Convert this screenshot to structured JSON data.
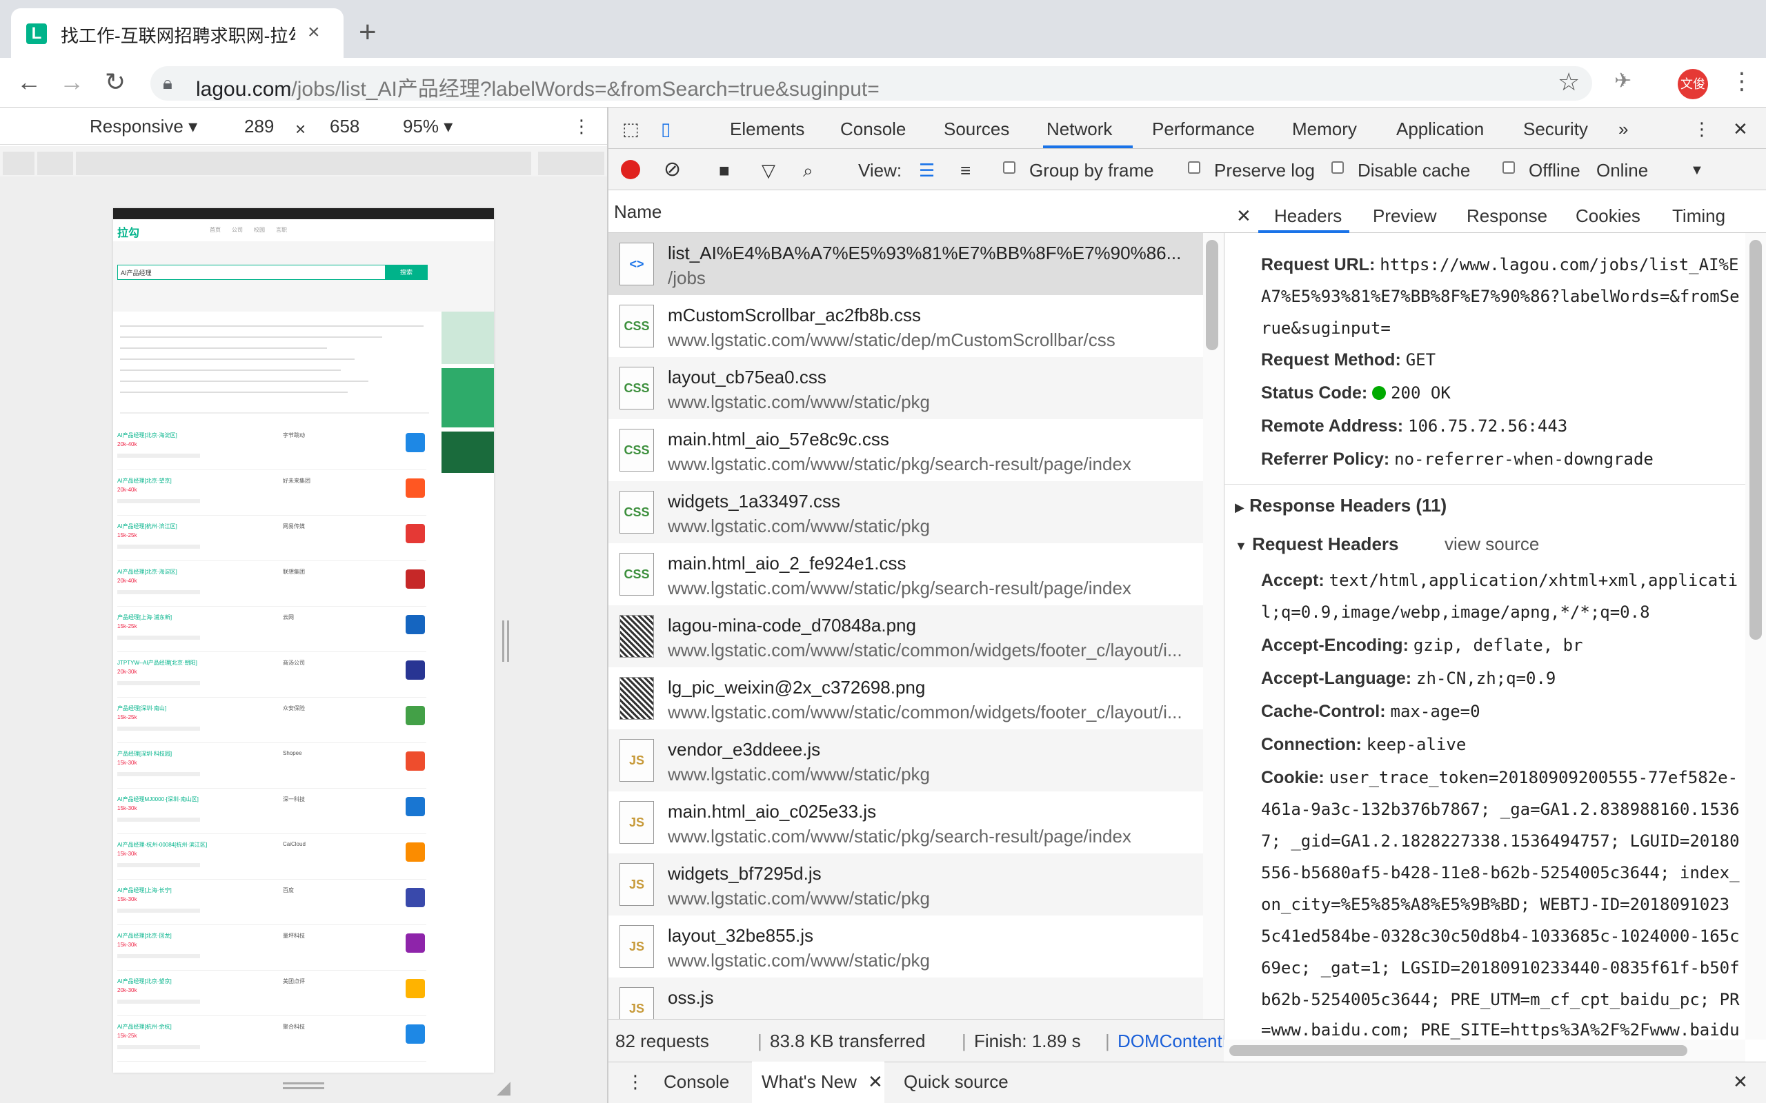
{
  "browser": {
    "tab_title": "找工作-互联网招聘求职网-拉勾网",
    "url_host": "lagou.com",
    "url_path": "/jobs/list_AI产品经理?labelWords=&fromSearch=true&suginput=",
    "profile": "文俊"
  },
  "device_toolbar": {
    "mode": "Responsive",
    "width": "289",
    "times": "×",
    "height": "658",
    "zoom": "95%"
  },
  "page_preview": {
    "logo": "拉勾",
    "search_value": "AI产品经理",
    "search_button": "搜索",
    "jobs": [
      {
        "title": "AI产品经理[北京·海淀区]",
        "salary": "20k-40k",
        "company": "字节跳动"
      },
      {
        "title": "AI产品经理[北京·望京]",
        "salary": "20k-40k",
        "company": "好未来集团"
      },
      {
        "title": "AI产品经理[杭州·滨江区]",
        "salary": "15k-25k",
        "company": "网易传媒"
      },
      {
        "title": "AI产品经理[北京·海淀区]",
        "salary": "20k-40k",
        "company": "联想集团"
      },
      {
        "title": "产品经理[上海·浦东新]",
        "salary": "15k-25k",
        "company": "云网"
      },
      {
        "title": "JTPTYW--AI产品经理[北京·朝阳]",
        "salary": "20k-30k",
        "company": "商汤公司"
      },
      {
        "title": "产品经理[深圳·南山]",
        "salary": "15k-25k",
        "company": "众安保险"
      },
      {
        "title": "产品经理[深圳·科技园]",
        "salary": "15k-30k",
        "company": "Shopee"
      },
      {
        "title": "AI产品经理MJ0000·[深圳·南山区]",
        "salary": "15k-30k",
        "company": "深一科技"
      },
      {
        "title": "AI产品经理-杭州-00084[杭州·滨江区]",
        "salary": "15k-30k",
        "company": "CaiCloud"
      },
      {
        "title": "AI产品经理[上海·长宁]",
        "salary": "15k-30k",
        "company": "百度"
      },
      {
        "title": "AI产品经理[北京·回龙]",
        "salary": "15k-30k",
        "company": "量坪科技"
      },
      {
        "title": "AI产品经理[北京·望京]",
        "salary": "20k-30k",
        "company": "美团点评"
      },
      {
        "title": "AI产品经理[杭州·余杭]",
        "salary": "15k-25k",
        "company": "聚合科技"
      }
    ]
  },
  "devtools": {
    "tabs": [
      "Elements",
      "Console",
      "Sources",
      "Network",
      "Performance",
      "Memory",
      "Application",
      "Security"
    ],
    "active_tab": "Network",
    "more": "»",
    "toolbar": {
      "view_label": "View:",
      "group_by_frame": "Group by frame",
      "preserve_log": "Preserve log",
      "disable_cache": "Disable cache",
      "offline": "Offline",
      "throttle": "Online"
    },
    "list_header": "Name",
    "requests": [
      {
        "name": "list_AI%E4%BA%A7%E5%93%81%E7%BB%8F%E7%90%86...",
        "path": "/jobs",
        "type": "doc",
        "icon_text": "<>"
      },
      {
        "name": "mCustomScrollbar_ac2fb8b.css",
        "path": "www.lgstatic.com/www/static/dep/mCustomScrollbar/css",
        "type": "css",
        "icon_text": "CSS"
      },
      {
        "name": "layout_cb75ea0.css",
        "path": "www.lgstatic.com/www/static/pkg",
        "type": "css",
        "icon_text": "CSS"
      },
      {
        "name": "main.html_aio_57e8c9c.css",
        "path": "www.lgstatic.com/www/static/pkg/search-result/page/index",
        "type": "css",
        "icon_text": "CSS"
      },
      {
        "name": "widgets_1a33497.css",
        "path": "www.lgstatic.com/www/static/pkg",
        "type": "css",
        "icon_text": "CSS"
      },
      {
        "name": "main.html_aio_2_fe924e1.css",
        "path": "www.lgstatic.com/www/static/pkg/search-result/page/index",
        "type": "css",
        "icon_text": "CSS"
      },
      {
        "name": "lagou-mina-code_d70848a.png",
        "path": "www.lgstatic.com/www/static/common/widgets/footer_c/layout/i...",
        "type": "img",
        "icon_text": ""
      },
      {
        "name": "lg_pic_weixin@2x_c372698.png",
        "path": "www.lgstatic.com/www/static/common/widgets/footer_c/layout/i...",
        "type": "img",
        "icon_text": ""
      },
      {
        "name": "vendor_e3ddeee.js",
        "path": "www.lgstatic.com/www/static/pkg",
        "type": "js",
        "icon_text": "JS"
      },
      {
        "name": "main.html_aio_c025e33.js",
        "path": "www.lgstatic.com/www/static/pkg/search-result/page/index",
        "type": "js",
        "icon_text": "JS"
      },
      {
        "name": "widgets_bf7295d.js",
        "path": "www.lgstatic.com/www/static/pkg",
        "type": "js",
        "icon_text": "JS"
      },
      {
        "name": "layout_32be855.js",
        "path": "www.lgstatic.com/www/static/pkg",
        "type": "js",
        "icon_text": "JS"
      },
      {
        "name": "oss.js",
        "path": "",
        "type": "js",
        "icon_text": "JS"
      }
    ],
    "status_bar": {
      "requests": "82 requests",
      "transferred": "83.8 KB transferred",
      "finish": "Finish: 1.89 s",
      "dcl": "DOMContentLoaded: ..."
    },
    "detail_tabs": [
      "Headers",
      "Preview",
      "Response",
      "Cookies",
      "Timing"
    ],
    "general": {
      "request_url_label": "Request URL:",
      "request_url_1": "https://www.lagou.com/jobs/list_AI%E",
      "request_url_2": "A7%E5%93%81%E7%BB%8F%E7%90%86?labelWords=&fromSe",
      "request_url_3": "rue&suginput=",
      "method_label": "Request Method:",
      "method": "GET",
      "status_label": "Status Code:",
      "status": "200 OK",
      "status_color": "#0a0",
      "remote_label": "Remote Address:",
      "remote": "106.75.72.56:443",
      "referrer_label": "Referrer Policy:",
      "referrer": "no-referrer-when-downgrade"
    },
    "response_headers": "Response Headers (11)",
    "request_headers": "Request Headers",
    "view_source": "view source",
    "req_headers": {
      "accept_label": "Accept:",
      "accept_1": "text/html,application/xhtml+xml,applicati",
      "accept_2": "l;q=0.9,image/webp,image/apng,*/*;q=0.8",
      "enc_label": "Accept-Encoding:",
      "enc": "gzip, deflate, br",
      "lang_label": "Accept-Language:",
      "lang": "zh-CN,zh;q=0.9",
      "cache_label": "Cache-Control:",
      "cache": "max-age=0",
      "conn_label": "Connection:",
      "conn": "keep-alive",
      "cookie_label": "Cookie:",
      "cookie_1": "user_trace_token=20180909200555-77ef582e-",
      "cookie_2": "461a-9a3c-132b376b7867; _ga=GA1.2.838988160.1536",
      "cookie_3": "7; _gid=GA1.2.1828227338.1536494757; LGUID=20180",
      "cookie_4": "556-b5680af5-b428-11e8-b62b-5254005c3644; index_",
      "cookie_5": "on_city=%E5%85%A8%E5%9B%BD; WEBTJ-ID=2018091023",
      "cookie_6": "5c41ed584be-0328c30c50d8b4-1033685c-1024000-165c",
      "cookie_7": "69ec; _gat=1; LGSID=20180910233440-0835f61f-b50f",
      "cookie_8": "b62b-5254005c3644; PRE_UTM=m_cf_cpt_baidu_pc; PR",
      "cookie_9": "=www.baidu.com; PRE_SITE=https%3A%2F%2Fwww.baidu"
    },
    "drawer": {
      "console": "Console",
      "whats_new": "What's New",
      "quick_source": "Quick source"
    }
  },
  "colors": {
    "accent": "#1a73e8",
    "lagou_green": "#00b38a",
    "record_red": "#e0221e",
    "css_icon": "#3c8f3c",
    "js_icon": "#c79a3a",
    "doc_icon": "#1a73e8"
  }
}
